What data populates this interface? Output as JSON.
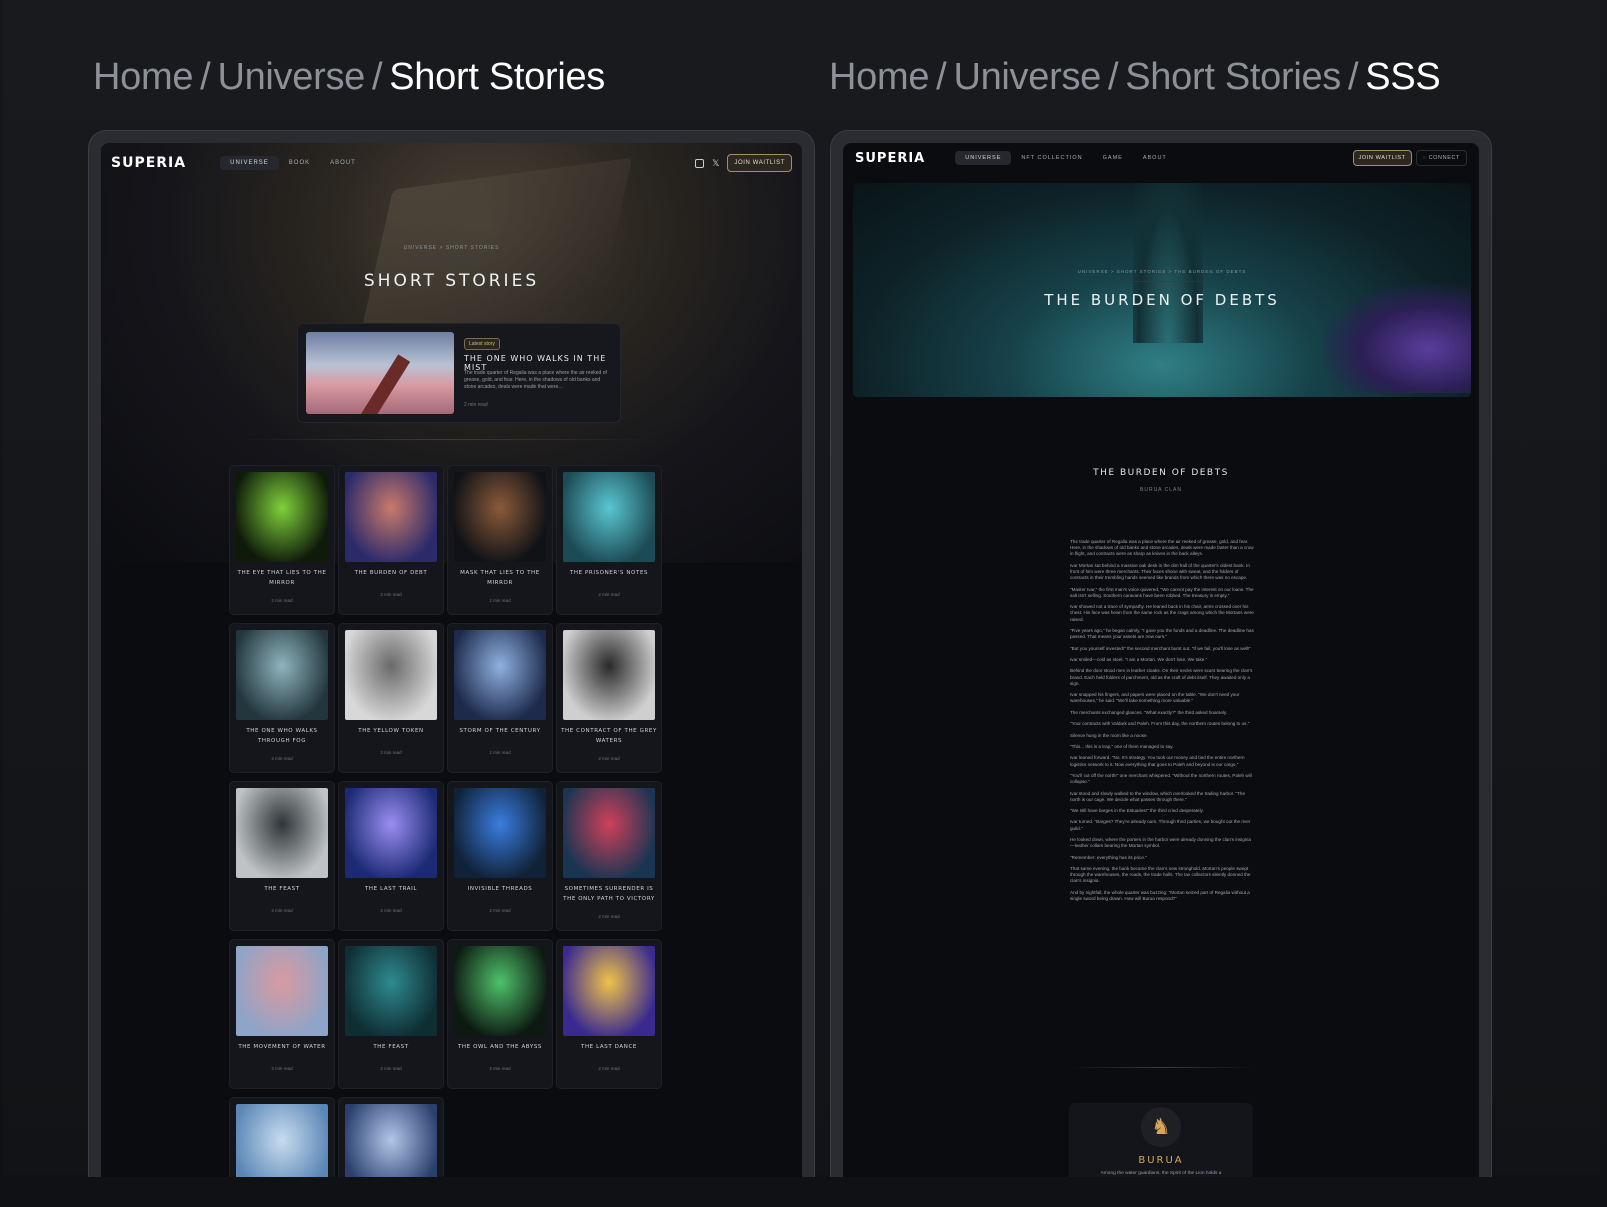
{
  "headings": {
    "left": {
      "crumb1": "Home",
      "crumb2": "Universe",
      "current": "Short Stories"
    },
    "right": {
      "crumb1": "Home",
      "crumb2": "Universe",
      "crumb3": "Short Stories",
      "current": "SSS"
    },
    "separator": "/"
  },
  "left": {
    "nav": {
      "logo": "SUPERIA",
      "links": [
        "UNIVERSE",
        "BOOK",
        "ABOUT"
      ],
      "icons": [
        "instagram-icon",
        "x-twitter-icon"
      ],
      "cta": "JOIN WAITLIST"
    },
    "hero": {
      "crumb": "UNIVERSE  >  SHORT STORIES",
      "title": "SHORT STORIES"
    },
    "latest": {
      "badge": "Latest story",
      "title": "THE ONE WHO WALKS IN THE MIST",
      "excerpt": "The trade quarter of Regalia was a place where the air reeked of grease, gold, and fear. Here, in the shadows of old banks and stone arcades, deals were made that were…",
      "read": "2 min read"
    },
    "stories": [
      {
        "title": "THE EYE THAT LIES TO THE MIRROR",
        "read": "2 min read",
        "c1": "#0f1a0a",
        "c2": "#7fd13a"
      },
      {
        "title": "THE BURDEN OF DEBT",
        "read": "2 min read",
        "c1": "#2b2a6b",
        "c2": "#c97a6a"
      },
      {
        "title": "MASK THAT LIES TO THE MIRROR",
        "read": "2 min read",
        "c1": "#101216",
        "c2": "#8a5a3a"
      },
      {
        "title": "THE PRISONER'S NOTES",
        "read": "2 min read",
        "c1": "#1c4b55",
        "c2": "#59c6d1"
      },
      {
        "title": "THE ONE WHO WALKS THROUGH FOG",
        "read": "2 min read",
        "c1": "#23363d",
        "c2": "#8fb4bd"
      },
      {
        "title": "THE YELLOW TOKEN",
        "read": "2 min read",
        "c1": "#d8d8d8",
        "c2": "#6a6a6a"
      },
      {
        "title": "STORM OF THE CENTURY",
        "read": "2 min read",
        "c1": "#1d2a4c",
        "c2": "#8fb1e0"
      },
      {
        "title": "THE CONTRACT OF THE GREY WATERS",
        "read": "2 min read",
        "c1": "#cfcfcf",
        "c2": "#2a2a2a"
      },
      {
        "title": "THE FEAST",
        "read": "2 min read",
        "c1": "#bfc3c5",
        "c2": "#2f3538"
      },
      {
        "title": "THE LAST TRAIL",
        "read": "2 min read",
        "c1": "#1b2a73",
        "c2": "#9a8df2"
      },
      {
        "title": "INVISIBLE THREADS",
        "read": "2 min read",
        "c1": "#102238",
        "c2": "#3a7de0"
      },
      {
        "title": "SOMETIMES SURRENDER IS THE ONLY PATH TO VICTORY",
        "read": "2 min read",
        "c1": "#1a3552",
        "c2": "#d0405a"
      },
      {
        "title": "THE MOVEMENT OF WATER",
        "read": "2 min read",
        "c1": "#8ea4c8",
        "c2": "#d99aa0"
      },
      {
        "title": "THE  FEAST",
        "read": "2 min read",
        "c1": "#0e2e34",
        "c2": "#2f8a8f"
      },
      {
        "title": "THE OWL AND THE ABYSS",
        "read": "2 min read",
        "c1": "#0d1a12",
        "c2": "#4fc26b"
      },
      {
        "title": "THE LAST DANCE",
        "read": "2 min read",
        "c1": "#3a2a8f",
        "c2": "#f0c24a"
      },
      {
        "title": "",
        "read": "",
        "c1": "#5a86b5",
        "c2": "#c7dcef"
      },
      {
        "title": "",
        "read": "",
        "c1": "#2b3f6e",
        "c2": "#b0c7e8"
      }
    ]
  },
  "right": {
    "nav": {
      "logo": "SUPERIA",
      "links": [
        "UNIVERSE",
        "NFT COLLECTION",
        "GAME",
        "ABOUT"
      ],
      "cta": "JOIN WAITLIST",
      "connect": "CONNECT"
    },
    "hero": {
      "crumb": "UNIVERSE  >  SHORT STORIES  >  THE BURDEN OF DEBTS",
      "title": "THE BURDEN OF DEBTS"
    },
    "story": {
      "title": "THE BURDEN OF DEBTS",
      "clan": "BURUA CLAN",
      "paragraphs": [
        "The trade quarter of Regalia was a place where the air reeked of grease, gold, and fear. Here, in the shadows of old banks and stone arcades, deals were made faster than a crow in flight, and contracts were as sharp as knives in the back alleys.",
        "Ivar Mortan sat behind a massive oak desk in the dim hall of the quarter's oldest bank. In front of him were three merchants. Their faces shone with sweat, and the folders of contracts in their trembling hands seemed like brands from which there was no escape.",
        "\"Master Ivar,\" the first man's voice quivered, \"We cannot pay the interest on our loans. The salt isn't selling. Southern caravans have been robbed. The treasury is empty.\"",
        "Ivar showed not a trace of sympathy. He leaned back in his chair, arms crossed over his chest. His face was hewn from the same rock as the crags among which the Mortans were raised.",
        "\"Five years ago,\" he began calmly, \"I gave you the funds and a deadline. The deadline has passed. That means your assets are now ours.\"",
        "\"But you yourself invested!\" the second merchant burst out. \"If we fail, you'll lose as well!\"",
        "Ivar smiled—cold as steel. \"I am a Mortan. We don't lose. We take.\"",
        "Behind the door stood men in leather cloaks. On their necks were scars bearing the clan's brand. Each held folders of parchment, old as the craft of debt itself. They awaited only a sign.",
        "Ivar snapped his fingers, and papers were placed on the table. \"We don't need your warehouses,\" he said. \"We'll take something more valuable.\"",
        "The merchants exchanged glances. \"What exactly?\" the third asked hoarsely.",
        "\"Your contracts with Valdark and Paleh. From this day, the northern routes belong to us.\"",
        "Silence hung in the room like a noose.",
        "\"This... this is a trap,\" one of them managed to say.",
        "Ivar leaned forward. \"No. It's strategy. You took our money and tied the entire northern logistics network to it. Now everything that goes to Paleh and beyond is our cargo.\"",
        "\"You'll cut off the north!\" one merchant whispered. \"Without the northern routes, Paleh will collapse.\"",
        "Ivar stood and slowly walked to the window, which overlooked the trading harbor. \"The north is our cage. We decide what passes through there.\"",
        "\"We still have barges in the Estuaries!\" the third cried desperately.",
        "Ivar turned. \"Barges? They're already ours. Through third parties, we bought out the river guild.\"",
        "He looked down, where the porters in the harbor were already donning the clan's insignia—leather collars bearing the Mortan symbol.",
        "\"Remember: everything has its price.\"",
        "That same evening, the bank became the clan's new stronghold. Mortan's people swept through the warehouses, the roads, the trade halls. The tax collectors silently donned the clan's insignia.",
        "And by nightfall, the whole quarter was buzzing: \"Mortan seized part of Regalia without a single sword being drawn. How will Burua respond?\""
      ],
      "clan_card": {
        "crest_icon": "lion-crest-icon",
        "name": "BURUA",
        "text": "Among the water guardians, the Spirit of the Lion holds a"
      }
    }
  }
}
